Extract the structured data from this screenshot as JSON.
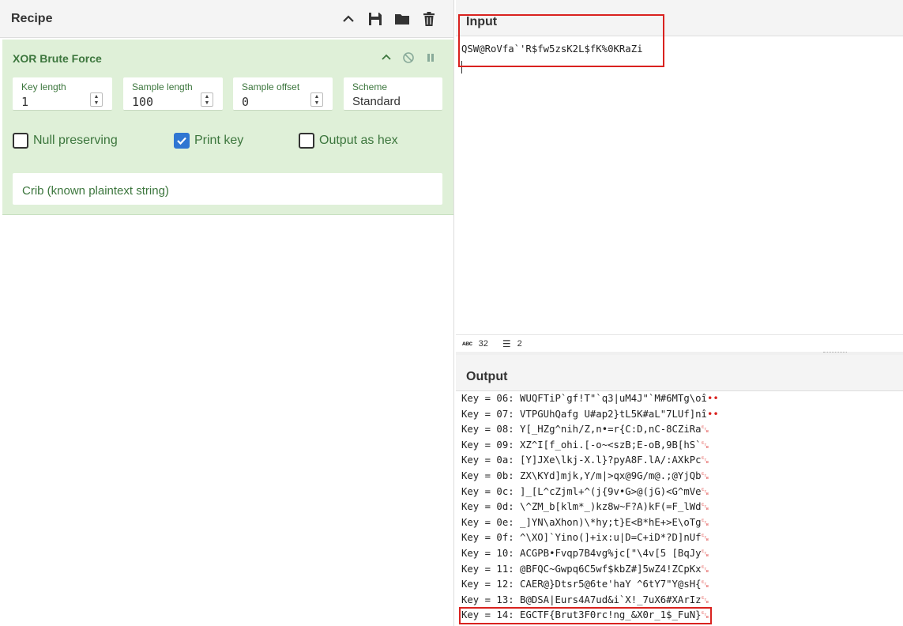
{
  "recipe": {
    "title": "Recipe",
    "icons": {
      "collapse": "chevron-up-icon",
      "save": "save-icon",
      "load": "folder-icon",
      "clear": "trash-icon"
    },
    "operation": {
      "title": "XOR Brute Force",
      "fields": {
        "key_length": {
          "label": "Key length",
          "value": "1"
        },
        "sample_length": {
          "label": "Sample length",
          "value": "100"
        },
        "sample_offset": {
          "label": "Sample offset",
          "value": "0"
        },
        "scheme": {
          "label": "Scheme",
          "value": "Standard"
        }
      },
      "checkboxes": {
        "null_preserving": {
          "label": "Null preserving",
          "checked": false
        },
        "print_key": {
          "label": "Print key",
          "checked": true
        },
        "output_hex": {
          "label": "Output as hex",
          "checked": false
        }
      },
      "crib": {
        "placeholder": "Crib (known plaintext string)"
      }
    }
  },
  "input": {
    "title": "Input",
    "text": "QSW@RoVfa`'R$fw5zsK2L$fK%0KRaZi",
    "status": {
      "chars": "32",
      "lines": "2"
    }
  },
  "output": {
    "title": "Output",
    "lines": [
      {
        "key": "Key = 06: ",
        "text": "WUQFTiP`gf!T\"`q3|uM4J\"`M#6MTg\\oî",
        "tail": "••"
      },
      {
        "key": "Key = 07: ",
        "text": "VTPGUhQafg U#ap2}tL5K#aL\"7LUf]nî",
        "tail": "••"
      },
      {
        "key": "Key = 08: ",
        "text": "Y[_HZg^nih/Z,n•=r{C:D,nC-8CZiRa",
        "tail": "␗"
      },
      {
        "key": "Key = 09: ",
        "text": "XZ^I[f_ohi.[-o~<szB;E-oB,9B[hS`",
        "tail": "␗"
      },
      {
        "key": "Key = 0a: ",
        "text": "[Y]JXe\\lkj-X.l}?pyA8F.lA/:AXkPc",
        "tail": "␗"
      },
      {
        "key": "Key = 0b: ",
        "text": "ZX\\KYd]mjk,Y/m|>qx@9G/m@.;@YjQb",
        "tail": "␗"
      },
      {
        "key": "Key = 0c: ",
        "text": "]_[L^cZjml+^(j{9v•G>@(jG)<G^mVe",
        "tail": "␗"
      },
      {
        "key": "Key = 0d: ",
        "text": "\\^ZM_b[klm*_)kz8w~F?A)kF(=F_lWd",
        "tail": "␗"
      },
      {
        "key": "Key = 0e: ",
        "text": "_]YN\\aXhon)\\*hy;t}E<B*hE+>E\\oTg",
        "tail": "␗"
      },
      {
        "key": "Key = 0f: ",
        "text": "^\\XO]`Yino(]+ix:u|D=C+iD*?D]nUf",
        "tail": "␗"
      },
      {
        "key": "Key = 10: ",
        "text": "ACGPB•Fvqp7B4vg%jc[\"\\4v[5 [BqJy",
        "tail": "␗"
      },
      {
        "key": "Key = 11: ",
        "text": "@BFQC~Gwpq6C5wf$kbZ#]5wZ4!ZCpKx",
        "tail": "␗"
      },
      {
        "key": "Key = 12: ",
        "text": "CAER@}Dtsr5@6te'haY ^6tY7\"Y@sH{",
        "tail": "␗"
      },
      {
        "key": "Key = 13: ",
        "text": "B@DSA|Eurs4A7ud&i`X!_7uX6#XArIz",
        "tail": "␗"
      },
      {
        "key": "Key = 14: ",
        "text": "EGCTF{Brut3F0rc!ng_&X0r_1$_FuN}",
        "tail": "␗"
      }
    ]
  }
}
